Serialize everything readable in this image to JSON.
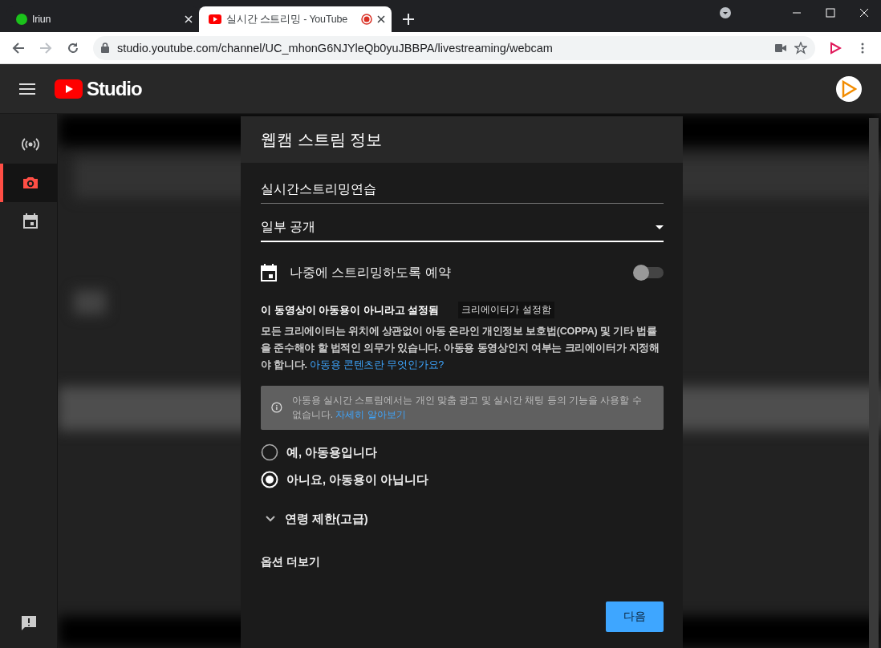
{
  "browser": {
    "tabs": [
      {
        "title": "Iriun",
        "selected": false,
        "recording": false
      },
      {
        "title": "실시간 스트리밍 - YouTube",
        "selected": true,
        "recording": true
      }
    ],
    "address": "studio.youtube.com/channel/UC_mhonG6NJYleQb0yuJBBPA/livestreaming/webcam"
  },
  "header": {
    "logo_text": "Studio"
  },
  "sidebar": {
    "items": [
      {
        "selected": false
      },
      {
        "selected": true
      },
      {
        "selected": false
      }
    ]
  },
  "dialog": {
    "title": "웹캠 스트림 정보",
    "title_field": {
      "value": "실시간스트리밍연습"
    },
    "visibility": {
      "value": "일부 공개"
    },
    "schedule": {
      "label": "나중에 스트리밍하도록 예약",
      "on": false
    },
    "audience": {
      "heading": "이 동영상이 아동용이 아니라고 설정됨",
      "badge": "크리에이터가 설정함",
      "description": "모든 크리에이터는 위치에 상관없이 아동 온라인 개인정보 보호법(COPPA) 및 기타 법률을 준수해야 할 법적인 의무가 있습니다. 아동용 동영상인지 여부는 크리에이터가 지정해야 합니다.",
      "link": "아동용 콘텐츠란 무엇인가요?",
      "notice": "아동용 실시간 스트림에서는 개인 맞춤 광고 및 실시간 채팅 등의 기능을 사용할 수 없습니다.",
      "notice_link": "자세히 알아보기",
      "options": [
        {
          "label": "예, 아동용입니다",
          "selected": false
        },
        {
          "label": "아니요, 아동용이 아닙니다",
          "selected": true
        }
      ]
    },
    "age_restriction": {
      "label": "연령 제한(고급)",
      "expanded": false
    },
    "more_options": "옵션 더보기",
    "next_button": "다음"
  }
}
